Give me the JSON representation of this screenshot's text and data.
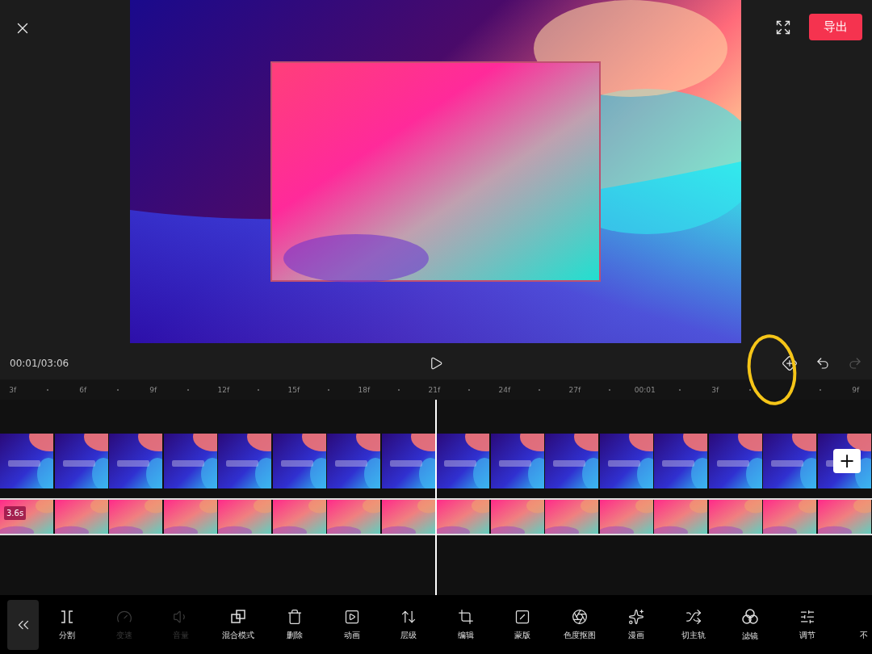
{
  "top_bar": {
    "export_button": "导出"
  },
  "player": {
    "time": "00:01/03:06",
    "undo_disabled": false,
    "redo_disabled": true
  },
  "ruler": [
    {
      "kind": "label",
      "label": "3f"
    },
    {
      "kind": "label",
      "label": "6f"
    },
    {
      "kind": "label",
      "label": "9f"
    },
    {
      "kind": "label",
      "label": "12f"
    },
    {
      "kind": "label",
      "label": "15f"
    },
    {
      "kind": "label",
      "label": "18f"
    },
    {
      "kind": "label",
      "label": "21f"
    },
    {
      "kind": "label",
      "label": "24f"
    },
    {
      "kind": "label",
      "label": "27f"
    },
    {
      "kind": "label",
      "label": "00:01"
    },
    {
      "kind": "label",
      "label": "3f"
    },
    {
      "kind": "covered"
    },
    {
      "kind": "label",
      "label": "9f"
    }
  ],
  "tracks": [
    {
      "kind": "title_clip"
    },
    {
      "kind": "overlay_clip",
      "duration": "3.6s"
    }
  ],
  "add_button": "+",
  "toolbar": [
    {
      "label": "分割",
      "disabled": false
    },
    {
      "label": "变速",
      "disabled": true
    },
    {
      "label": "音量",
      "disabled": true
    },
    {
      "label": "混合模式",
      "disabled": false
    },
    {
      "label": "删除",
      "disabled": false
    },
    {
      "label": "动画",
      "disabled": false
    },
    {
      "label": "层级",
      "disabled": false
    },
    {
      "label": "编辑",
      "disabled": false
    },
    {
      "label": "蒙版",
      "disabled": false
    },
    {
      "label": "色度抠图",
      "disabled": false
    },
    {
      "label": "漫画",
      "disabled": false
    },
    {
      "label": "切主轨",
      "disabled": false
    },
    {
      "label": "滤镜",
      "disabled": false
    },
    {
      "label": "调节",
      "disabled": false
    },
    {
      "label": "不",
      "disabled": false
    }
  ]
}
